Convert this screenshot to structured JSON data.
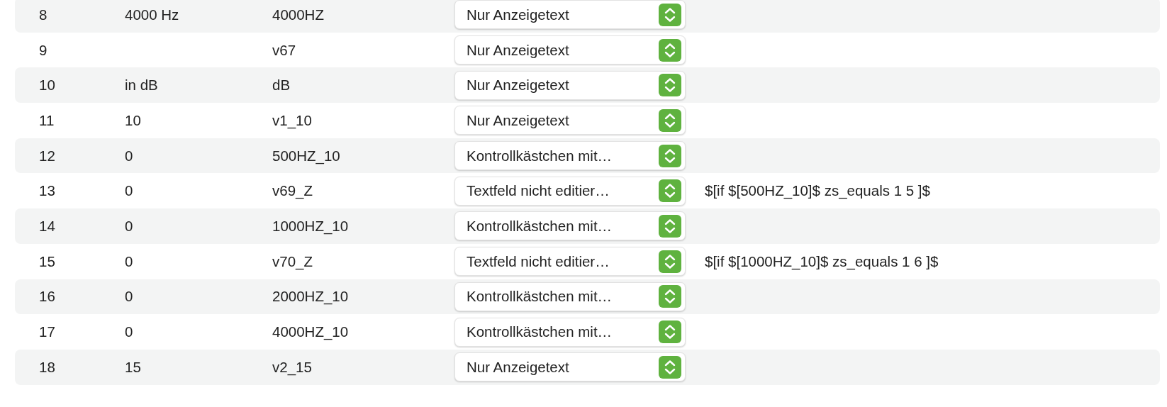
{
  "rows": [
    {
      "number": "8",
      "label": "4000 Hz",
      "variable": "4000HZ",
      "type": "Nur Anzeigetext"
    },
    {
      "number": "9",
      "variable": "v67",
      "type": "Nur Anzeigetext"
    },
    {
      "number": "10",
      "label": "in dB",
      "variable": "dB",
      "type": "Nur Anzeigetext"
    },
    {
      "number": "11",
      "label": "10",
      "variable": "v1_10",
      "type": "Nur Anzeigetext"
    },
    {
      "number": "12",
      "label": "0",
      "variable": "500HZ_10",
      "type": "Kontrollkästchen mit…"
    },
    {
      "number": "13",
      "label": "0",
      "variable": "v69_Z",
      "type": "Textfeld nicht editier…",
      "formula": "$[if $[500HZ_10]$ zs_equals 1 5 ]$"
    },
    {
      "number": "14",
      "label": "0",
      "variable": "1000HZ_10",
      "type": "Kontrollkästchen mit…"
    },
    {
      "number": "15",
      "label": "0",
      "variable": "v70_Z",
      "type": "Textfeld nicht editier…",
      "formula": "$[if $[1000HZ_10]$ zs_equals 1 6 ]$"
    },
    {
      "number": "16",
      "label": "0",
      "variable": "2000HZ_10",
      "type": "Kontrollkästchen mit…"
    },
    {
      "number": "17",
      "label": "0",
      "variable": "4000HZ_10",
      "type": "Kontrollkästchen mit…"
    },
    {
      "number": "18",
      "label": "15",
      "variable": "v2_15",
      "type": "Nur Anzeigetext"
    }
  ]
}
